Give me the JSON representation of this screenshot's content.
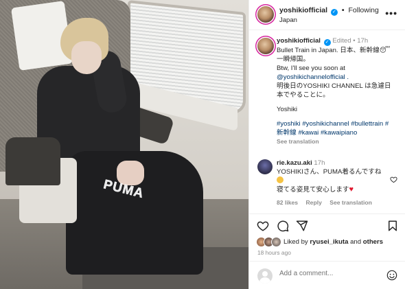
{
  "post": {
    "header": {
      "username": "yoshikiofficial",
      "follow_status": "Following",
      "separator": "•",
      "location": "Japan",
      "more_label": "•••"
    },
    "caption": {
      "username": "yoshikiofficial",
      "meta": "Edited • 17h",
      "lines": [
        "Bullet Train in Japan. 日本、新幹線😴",
        "一瞬帰国。",
        "Btw, I'll see you soon at",
        "@yoshikichannelofficial .",
        "明後日のYOSHIKI CHANNEL は急遽日",
        "本でやることに。",
        "Yoshiki",
        "#yoshiki #yoshikichannel #bullettrain #",
        "新幹線 #kawai #kawaipiano"
      ],
      "see_translation": "See translation"
    },
    "comment": {
      "username": "rie.kazu.aki",
      "time": "17h",
      "line1": "YOSHIKIさん、PUMA着るんですね",
      "line3": "寝てる姿見て安心します",
      "likes": "82 likes",
      "reply": "Reply",
      "see_translation": "See translation"
    },
    "actions": {
      "liked_by_prefix": "Liked by",
      "liked_by_user": "ryusei_ikuta",
      "liked_by_and": "and",
      "liked_by_others": "others",
      "time_ago": "18 hours ago"
    },
    "add_comment": {
      "placeholder": "Add a comment..."
    },
    "photo": {
      "brand_text": "PUMA"
    }
  },
  "colors": {
    "verified_badge": "#0095f6",
    "link_text": "#00376b",
    "secondary_text": "#8e8e8e",
    "heart_emoji": "#e0182f"
  },
  "icons": [
    "verified-icon",
    "more-icon",
    "heart-icon",
    "comment-icon",
    "share-icon",
    "save-icon",
    "emoji-icon",
    "sweat-emoji",
    "heart-emoji"
  ]
}
